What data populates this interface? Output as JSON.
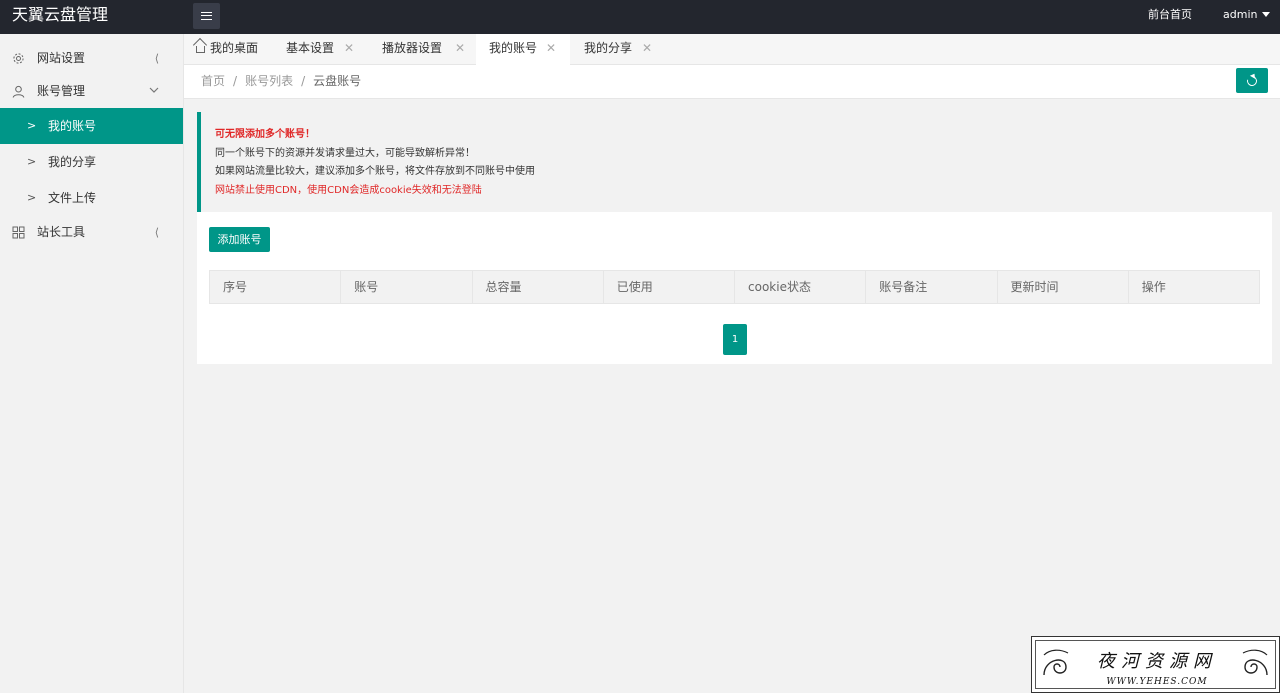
{
  "header": {
    "app_title": "天翼云盘管理",
    "front_link": "前台首页",
    "user": "admin"
  },
  "sidebar": {
    "groups": [
      {
        "label": "网站设置",
        "icon": "gear-icon",
        "expanded": false
      },
      {
        "label": "账号管理",
        "icon": "user-icon",
        "expanded": true,
        "items": [
          {
            "label": "我的账号",
            "active": true
          },
          {
            "label": "我的分享",
            "active": false
          },
          {
            "label": "文件上传",
            "active": false
          }
        ]
      },
      {
        "label": "站长工具",
        "icon": "grid-icon",
        "expanded": false
      }
    ]
  },
  "tabs": [
    {
      "label": "我的桌面",
      "closable": false
    },
    {
      "label": "基本设置",
      "closable": true
    },
    {
      "label": "播放器设置",
      "closable": true
    },
    {
      "label": "我的账号",
      "closable": true,
      "active": true
    },
    {
      "label": "我的分享",
      "closable": true
    }
  ],
  "breadcrumb": [
    "首页",
    "账号列表",
    "云盘账号"
  ],
  "notice": {
    "title": "可无限添加多个账号！",
    "line1": "同一个账号下的资源并发请求量过大，可能导致解析异常！",
    "line2": "如果网站流量比较大，建议添加多个账号，将文件存放到不同账号中使用",
    "warning": "网站禁止使用CDN，使用CDN会造成cookie失效和无法登陆"
  },
  "toolbar": {
    "add_label": "添加账号"
  },
  "table": {
    "columns": [
      "序号",
      "账号",
      "总容量",
      "已使用",
      "cookie状态",
      "账号备注",
      "更新时间",
      "操作"
    ],
    "rows": []
  },
  "pagination": {
    "current": "1"
  },
  "watermark": {
    "name": "夜河资源网",
    "url": "WWW.YEHES.COM"
  },
  "colors": {
    "accent": "#009688",
    "header_bg": "#23262e",
    "warning": "#e02828"
  }
}
